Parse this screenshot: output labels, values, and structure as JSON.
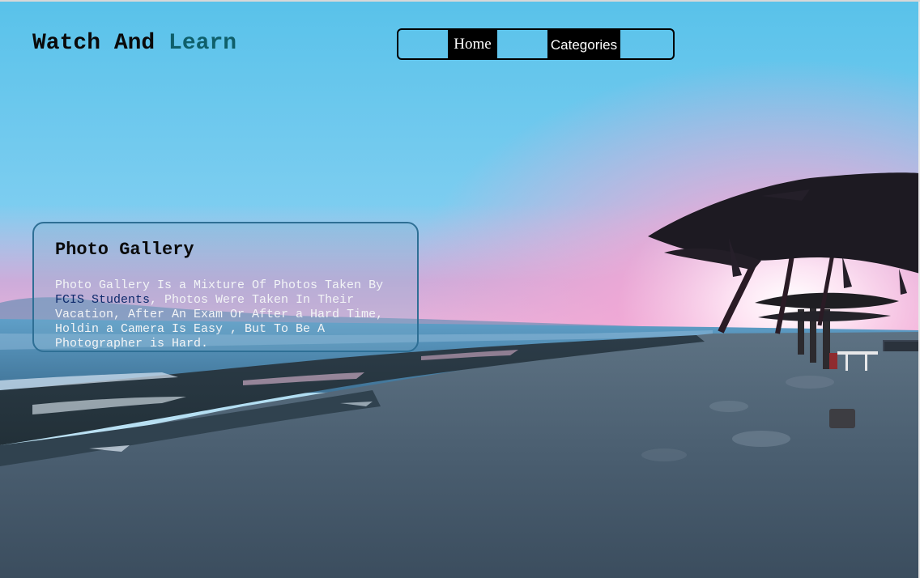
{
  "header": {
    "title_part1": "Watch And ",
    "title_part2": "Learn"
  },
  "nav": {
    "items": [
      {
        "label": "Home"
      },
      {
        "label": "Categories"
      }
    ]
  },
  "info_card": {
    "title": "Photo Gallery",
    "text_before": "Photo Gallery Is a Mixture Of Photos Taken By ",
    "text_highlight": "FCIS Students",
    "text_after": ", Photos Were Taken In Their Vacation, After An Exam Or After a Hard Time, Holdin a Camera Is Easy , But To Be A Photographer is Hard."
  },
  "background": {
    "scene": "beach-sunset-photo"
  },
  "colors": {
    "title_accent": "#0f5f6a",
    "nav_item_bg": "#000000",
    "card_border": "#2e6f95",
    "highlight_text": "#0d2a6b"
  }
}
